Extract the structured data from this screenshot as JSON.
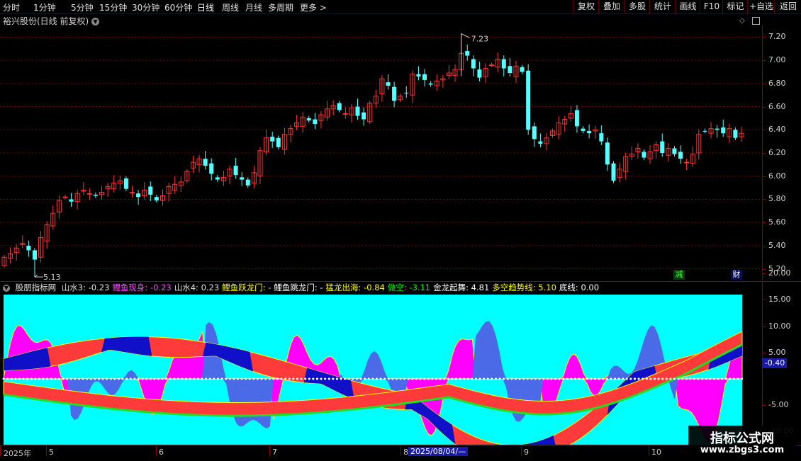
{
  "toolbar": {
    "tabs": [
      "分时",
      "1分钟",
      "5分钟",
      "15分钟",
      "30分钟",
      "60分钟",
      "日线",
      "周线",
      "月线",
      "多周期",
      "更多 >"
    ],
    "active_tab": "日线",
    "right_buttons": [
      "复权",
      "叠加",
      "多股",
      "统计",
      "画线",
      "F10",
      "标记",
      "+自选",
      "返回"
    ]
  },
  "main": {
    "title": "裕兴股份(日线 前复权)",
    "high_label": "7.23",
    "low_label": "5.13",
    "badge_reduce": "减",
    "badge_finance": "财",
    "yaxis": [
      "7.20",
      "7.00",
      "6.80",
      "6.60",
      "6.40",
      "6.20",
      "6.00",
      "5.80",
      "5.60",
      "5.40",
      "5.20"
    ]
  },
  "indicator": {
    "name": "股朋指标网",
    "items": [
      {
        "label": "山水3: -0.23",
        "color": "#e0e0e0"
      },
      {
        "label": "鲤鱼现身: -0.23",
        "color": "#ff44ff"
      },
      {
        "label": "山水4: 0.23",
        "color": "#e0e0e0"
      },
      {
        "label": "鲤鱼跃龙门: -",
        "color": "#ffff00"
      },
      {
        "label": "鲤鱼跳龙门: -",
        "color": "#ffffff"
      },
      {
        "label": "猛龙出海: -0.84",
        "color": "#ffff00"
      },
      {
        "label": "做空: -3.11",
        "color": "#00ff00"
      },
      {
        "label": "金龙起舞: 4.81",
        "color": "#ffffff"
      },
      {
        "label": "多空趋势线: 5.10",
        "color": "#ffff00"
      },
      {
        "label": "底线: 0.00",
        "color": "#ffffff"
      }
    ],
    "yaxis": [
      "20.00",
      "15.00",
      "10.00",
      "5.00",
      "0.00",
      "-5.00",
      "-10.00"
    ],
    "current_value": "-0.40"
  },
  "xaxis": {
    "labels": [
      "2025年",
      "5",
      "6",
      "7",
      "8",
      "9",
      "10"
    ],
    "cursor_date": "2025/08/04/—"
  },
  "watermark": {
    "title": "指标公式网",
    "url": "www.zbgs3.com"
  },
  "colors": {
    "up": "#ff3232",
    "down": "#54ffff",
    "bg": "#000000",
    "grid": "#8b0000",
    "ind_bg": "#00ffff"
  },
  "chart_data": {
    "type": "candlestick",
    "ylim": [
      5.1,
      7.3
    ],
    "high": 7.23,
    "low": 5.13,
    "close": [
      5.3,
      5.33,
      5.38,
      5.42,
      5.36,
      5.28,
      5.47,
      5.58,
      5.68,
      5.79,
      5.82,
      5.78,
      5.85,
      5.88,
      5.85,
      5.83,
      5.86,
      5.91,
      5.94,
      5.96,
      5.89,
      5.86,
      5.82,
      5.88,
      5.84,
      5.79,
      5.83,
      5.91,
      5.93,
      5.95,
      6.04,
      6.12,
      6.15,
      6.09,
      6.02,
      5.97,
      5.99,
      6.06,
      6.01,
      5.97,
      5.92,
      6.03,
      6.22,
      6.33,
      6.3,
      6.25,
      6.36,
      6.41,
      6.46,
      6.51,
      6.48,
      6.45,
      6.53,
      6.58,
      6.61,
      6.57,
      6.54,
      6.59,
      6.52,
      6.49,
      6.63,
      6.69,
      6.84,
      6.78,
      6.65,
      6.69,
      6.72,
      6.88,
      6.86,
      6.83,
      6.79,
      6.82,
      6.84,
      6.89,
      6.92,
      7.06,
      7.04,
      6.93,
      6.85,
      6.93,
      6.96,
      7.01,
      6.93,
      6.89,
      6.95,
      6.9,
      6.4,
      6.32,
      6.28,
      6.33,
      6.39,
      6.46,
      6.49,
      6.54,
      6.43,
      6.39,
      6.37,
      6.4,
      6.3,
      6.1,
      5.96,
      6.06,
      6.17,
      6.19,
      6.24,
      6.16,
      6.21,
      6.27,
      6.2,
      6.24,
      6.19,
      6.15,
      6.12,
      6.19,
      6.36,
      6.39,
      6.41,
      6.4,
      6.37,
      6.41,
      6.33,
      6.37
    ],
    "indicator_series": [
      {
        "name": "山水3",
        "value": -0.23
      },
      {
        "name": "鲤鱼现身",
        "value": -0.23
      },
      {
        "name": "山水4",
        "value": 0.23
      },
      {
        "name": "猛龙出海",
        "value": -0.84
      },
      {
        "name": "做空",
        "value": -3.11
      },
      {
        "name": "金龙起舞",
        "value": 4.81
      },
      {
        "name": "多空趋势线",
        "value": 5.1
      },
      {
        "name": "底线",
        "value": 0.0
      }
    ]
  }
}
